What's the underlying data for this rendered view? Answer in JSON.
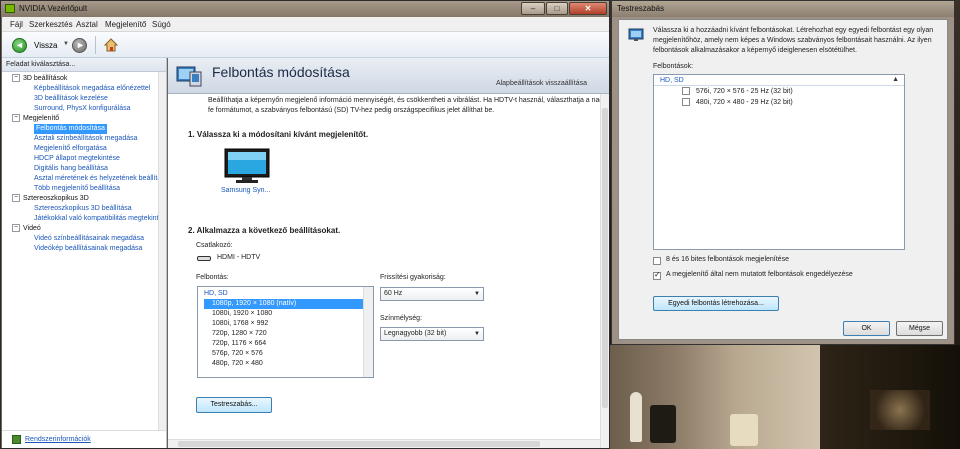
{
  "main_window": {
    "title": "NVIDIA Vezérlőpult",
    "controls": {
      "minimize": "–",
      "maximize": "□",
      "close": "✕"
    }
  },
  "menu": [
    "Fájl",
    "Szerkesztés",
    "Asztal",
    "Megjelenítő",
    "Súgó"
  ],
  "toolbar": {
    "back_label": "Vissza",
    "back_dropdown": "▼"
  },
  "left_panel": {
    "header": "Feladat kiválasztása...",
    "tree": [
      {
        "type": "cat",
        "label": "3D beállítások",
        "exp": "−"
      },
      {
        "type": "leaf",
        "label": "Képbeállítások megadása előnézettel"
      },
      {
        "type": "leaf",
        "label": "3D beállítások kezelése"
      },
      {
        "type": "leaf",
        "label": "Surround, PhysX konfigurálása"
      },
      {
        "type": "cat",
        "label": "Megjelenítő",
        "exp": "−"
      },
      {
        "type": "leaf",
        "label": "Felbontás módosítása",
        "selected": true
      },
      {
        "type": "leaf",
        "label": "Asztali színbeállítások megadása"
      },
      {
        "type": "leaf",
        "label": "Megjelenítő elforgatása"
      },
      {
        "type": "leaf",
        "label": "HDCP állapot megtekintése"
      },
      {
        "type": "leaf",
        "label": "Digitális hang beállítása"
      },
      {
        "type": "leaf",
        "label": "Asztal méretének és helyzetének beállítása"
      },
      {
        "type": "leaf",
        "label": "Több megjelenítő beállítása"
      },
      {
        "type": "cat",
        "label": "Sztereoszkopikus 3D",
        "exp": "−"
      },
      {
        "type": "leaf",
        "label": "Sztereoszkopikus 3D beállítása"
      },
      {
        "type": "leaf",
        "label": "Játékokkal való kompatibilitás megtekintése"
      },
      {
        "type": "cat",
        "label": "Videó",
        "exp": "−"
      },
      {
        "type": "leaf",
        "label": "Videó színbeállításainak megadása"
      },
      {
        "type": "leaf",
        "label": "Videókép beállításainak megadása"
      }
    ],
    "footer_link": "Rendszerinformációk"
  },
  "content": {
    "title": "Felbontás módosítása",
    "subtitle": "Alapbeállítások visszaállítása",
    "intro": "Beállíthatja a képernyőn megjelenő információ mennyiségét, és csökkentheti a vibrálást. Ha HDTV-t használ, választhatja a nagy fe formátumot, a szabványos felbontású (SD) TV-hez pedig országspecifikus jelet állíthat be.",
    "step1": "1. Válassza ki a módosítani kívánt megjelenítőt.",
    "display_name": "Samsung Syn...",
    "step2": "2. Alkalmazza a következő beállításokat.",
    "connector_label": "Csatlakozó:",
    "connector_value": "HDMI - HDTV",
    "resolution_label": "Felbontás:",
    "resolution_group": "HD, SD",
    "resolutions": [
      "1080p, 1920 × 1080 (natív)",
      "1080i, 1920 × 1080",
      "1080i, 1768 × 992",
      "720p, 1280 × 720",
      "720p, 1176 × 664",
      "576p, 720 × 576",
      "480p, 720 × 480"
    ],
    "selected_resolution_index": 0,
    "refresh_label": "Frissítési gyakoriság:",
    "refresh_value": "60 Hz",
    "depth_label": "Színmélység:",
    "depth_value": "Legnagyobb (32 bit)",
    "customize_button": "Testreszabás..."
  },
  "dialog": {
    "title": "Testreszabás",
    "text": "Válassza ki a hozzáadni kívánt felbontásokat. Létrehozhat egy egyedi felbontást egy olyan megjelenítőhöz, amely nem képes a Windows szabványos felbontásait használni. Az ilyen felbontások alkalmazásakor a képernyő ideiglenesen elsötétülhet.",
    "res_label": "Felbontások:",
    "group": "HD, SD",
    "rows": [
      {
        "label": "576i, 720 × 576 - 25 Hz (32 bit)",
        "checked": false
      },
      {
        "label": "480i, 720 × 480 - 29 Hz (32 bit)",
        "checked": false
      }
    ],
    "cb_8_16": "8 és 16 bites felbontások megjelenítése",
    "cb_8_16_checked": false,
    "cb_enable": "A megjelenítő által nem mutatott felbontások engedélyezése",
    "cb_enable_checked": true,
    "create_button": "Egyedi felbontás létrehozása...",
    "ok_button": "OK",
    "cancel_button": "Mégse"
  }
}
